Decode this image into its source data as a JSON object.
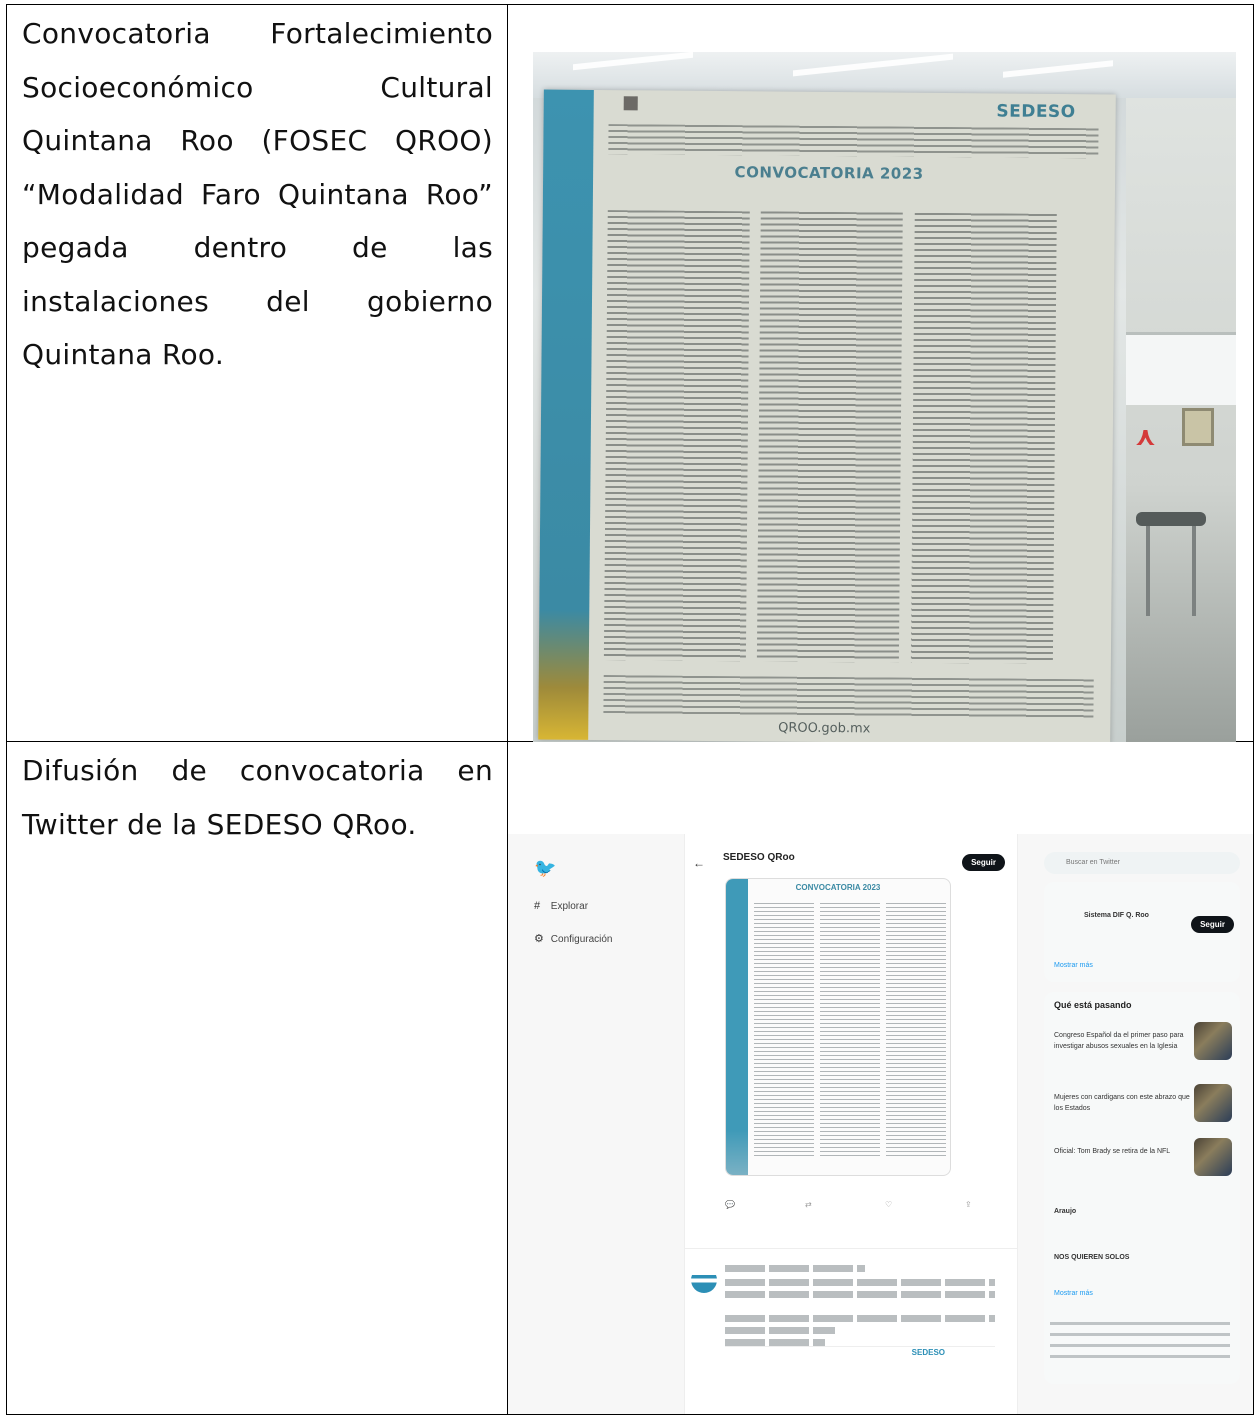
{
  "rows": [
    {
      "description": "Convocatoria Fortalecimiento Socioeconómico Cultural Quintana Roo (FOSEC QROO) “Modalidad Faro Quintana Roo” pegada dentro de las instalaciones del gobierno Quintana Roo.",
      "photo": {
        "poster_brand": "SEDESO",
        "poster_title": "CONVOCATORIA 2023",
        "poster_url": "QROO.gob.mx",
        "colors": {
          "poster_band": "#3d93b0",
          "poster_bg": "#d9dbd2"
        }
      }
    },
    {
      "description": "Difusión de convocatoria en Twitter de la SEDESO QRoo.",
      "twitter": {
        "nav_explore": "Explorar",
        "nav_settings": "Configuración",
        "account_name": "SEDESO QRoo",
        "follow_label": "Seguir",
        "search_placeholder": "Buscar en Twitter",
        "image_title": "CONVOCATORIA 2023",
        "suggested_account": "Sistema DIF Q. Roo",
        "suggested_follow": "Seguir",
        "show_more": "Mostrar más",
        "trends_heading": "Qué está pasando",
        "trends": [
          {
            "text": "Congreso Español da el primer paso para investigar abusos sexuales en la Iglesia"
          },
          {
            "text": "Mujeres con cardigans con este abrazo que los Estados"
          },
          {
            "text": "Oficial: Tom Brady se retira de la NFL"
          }
        ],
        "trend_words": [
          "Araujo",
          "NOS QUIEREN SOLOS"
        ],
        "accent": "#1d9bf0"
      }
    }
  ]
}
